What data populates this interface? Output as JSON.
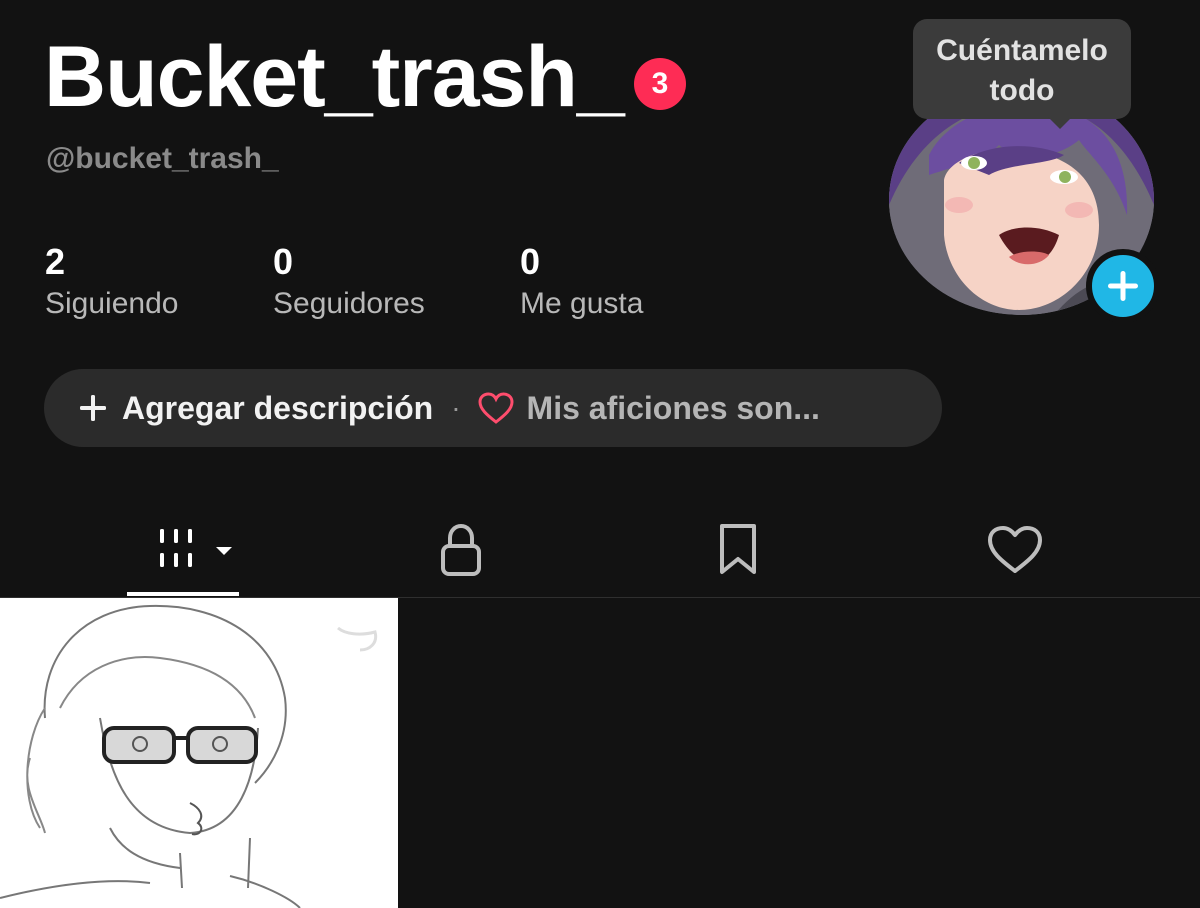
{
  "profile": {
    "display_name": "Bucket_trash_",
    "notification_count": "3",
    "username": "@bucket_trash_"
  },
  "stats": [
    {
      "value": "2",
      "label": "Siguiendo"
    },
    {
      "value": "0",
      "label": "Seguidores"
    },
    {
      "value": "0",
      "label": "Me gusta"
    }
  ],
  "avatar_tooltip": {
    "line1": "Cuéntamelo",
    "line2": "todo"
  },
  "description": {
    "add_label": "Agregar descripción",
    "separator": "·",
    "hobbies_label": "Mis aficiones son..."
  },
  "tabs": [
    {
      "icon": "grid-icon",
      "active": true
    },
    {
      "icon": "lock-icon",
      "active": false
    },
    {
      "icon": "bookmark-icon",
      "active": false
    },
    {
      "icon": "heart-icon",
      "active": false
    }
  ],
  "colors": {
    "background": "#121212",
    "badge": "#fe2c55",
    "add_button": "#20b7e6",
    "heart_outline": "#fe4d6d"
  }
}
